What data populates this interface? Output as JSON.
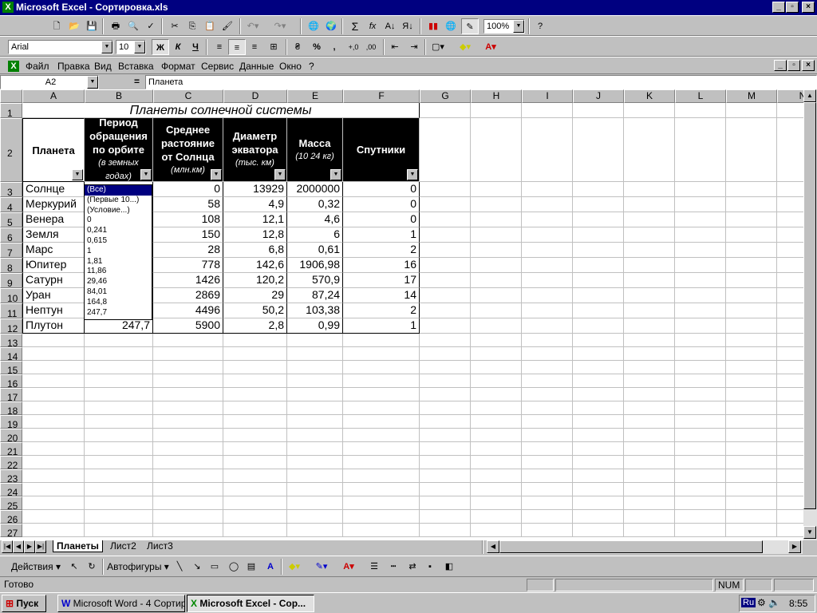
{
  "window": {
    "title": "Microsoft Excel - Сортировка.xls"
  },
  "standard_toolbar": {
    "zoom": "100%"
  },
  "format_toolbar": {
    "font": "Arial",
    "size": "10",
    "bold": "Ж",
    "italic": "К",
    "underline": "Ч",
    "percent": "%",
    "comma": ","
  },
  "menu": {
    "items": [
      "Файл",
      "Правка",
      "Вид",
      "Вставка",
      "Формат",
      "Сервис",
      "Данные",
      "Окно",
      "?"
    ]
  },
  "formula_bar": {
    "name_box": "A2",
    "equals": "=",
    "content": "Планета"
  },
  "columns": [
    "A",
    "B",
    "C",
    "D",
    "E",
    "F",
    "G",
    "H",
    "I",
    "J",
    "K",
    "L",
    "M",
    "N"
  ],
  "rows": [
    "1",
    "2",
    "3",
    "4",
    "5",
    "6",
    "7",
    "8",
    "9",
    "10",
    "11",
    "12",
    "13",
    "14",
    "15",
    "16",
    "17",
    "18",
    "19",
    "20",
    "21",
    "22",
    "23",
    "24",
    "25",
    "26",
    "27"
  ],
  "sheet": {
    "title": "Планеты солнечной системы",
    "headers": {
      "a": "Планета",
      "b_main": "Период обращения по орбите",
      "b_sub": "(в земных годах)",
      "c_main": "Среднее растояние от Солнца",
      "c_sub": "(млн.км)",
      "d_main": "Диаметр экватора",
      "d_sub": "(тыс. км)",
      "e_main": "Масса",
      "e_sub": "(10 24 кг)",
      "f": "Спутники"
    },
    "data": [
      [
        "Солнце",
        "",
        "0",
        "13929",
        "2000000",
        "0"
      ],
      [
        "Меркурий",
        "",
        "58",
        "4,9",
        "0,32",
        "0"
      ],
      [
        "Венера",
        "",
        "108",
        "12,1",
        "4,6",
        "0"
      ],
      [
        "Земля",
        "",
        "150",
        "12,8",
        "6",
        "1"
      ],
      [
        "Марс",
        "",
        "28",
        "6,8",
        "0,61",
        "2"
      ],
      [
        "Юпитер",
        "",
        "778",
        "142,6",
        "1906,98",
        "16"
      ],
      [
        "Сатурн",
        "",
        "1426",
        "120,2",
        "570,9",
        "17"
      ],
      [
        "Уран",
        "",
        "2869",
        "29",
        "87,24",
        "14"
      ],
      [
        "Нептун",
        "",
        "4496",
        "50,2",
        "103,38",
        "2"
      ],
      [
        "Плутон",
        "247,7",
        "5900",
        "2,8",
        "0,99",
        "1"
      ]
    ]
  },
  "filter_dropdown": {
    "options": [
      "(Все)",
      "(Первые 10...)",
      "(Условие...)",
      "0",
      "0,241",
      "0,615",
      "1",
      "1,81",
      "11,86",
      "29,46",
      "84,01",
      "164,8",
      "247,7"
    ]
  },
  "sheet_tabs": [
    "Планеты",
    "Лист2",
    "Лист3"
  ],
  "drawing_toolbar": {
    "actions": "Действия",
    "autoshapes": "Автофигуры"
  },
  "status_bar": {
    "ready": "Готово",
    "num": "NUM"
  },
  "taskbar": {
    "start": "Пуск",
    "word": "Microsoft Word - 4 Сортир...",
    "excel": "Microsoft Excel - Сор...",
    "lang": "Ru",
    "clock": "8:55"
  },
  "colors": {
    "title_bg": "#000080",
    "header_bg": "#000000",
    "dropdown_selected": "#000080",
    "chrome": "#c0c0c0"
  }
}
